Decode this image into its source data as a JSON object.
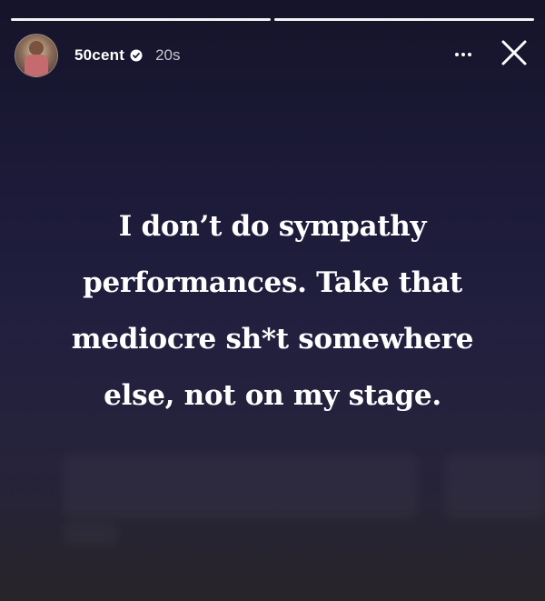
{
  "story": {
    "progress_segments": 2,
    "user": {
      "username": "50cent",
      "verified": true,
      "time_ago": "20s",
      "avatar_icon": "avatar-photo"
    },
    "header_icons": {
      "more": "more-horizontal-icon",
      "close": "close-icon"
    },
    "text_lines": [
      "I don’t do sympathy",
      "performances. Take that",
      "mediocre sh*t somewhere",
      "else, not on my stage."
    ],
    "colors": {
      "background_top": "#15142a",
      "background_bottom": "#272529",
      "text": "#ffffff"
    }
  }
}
